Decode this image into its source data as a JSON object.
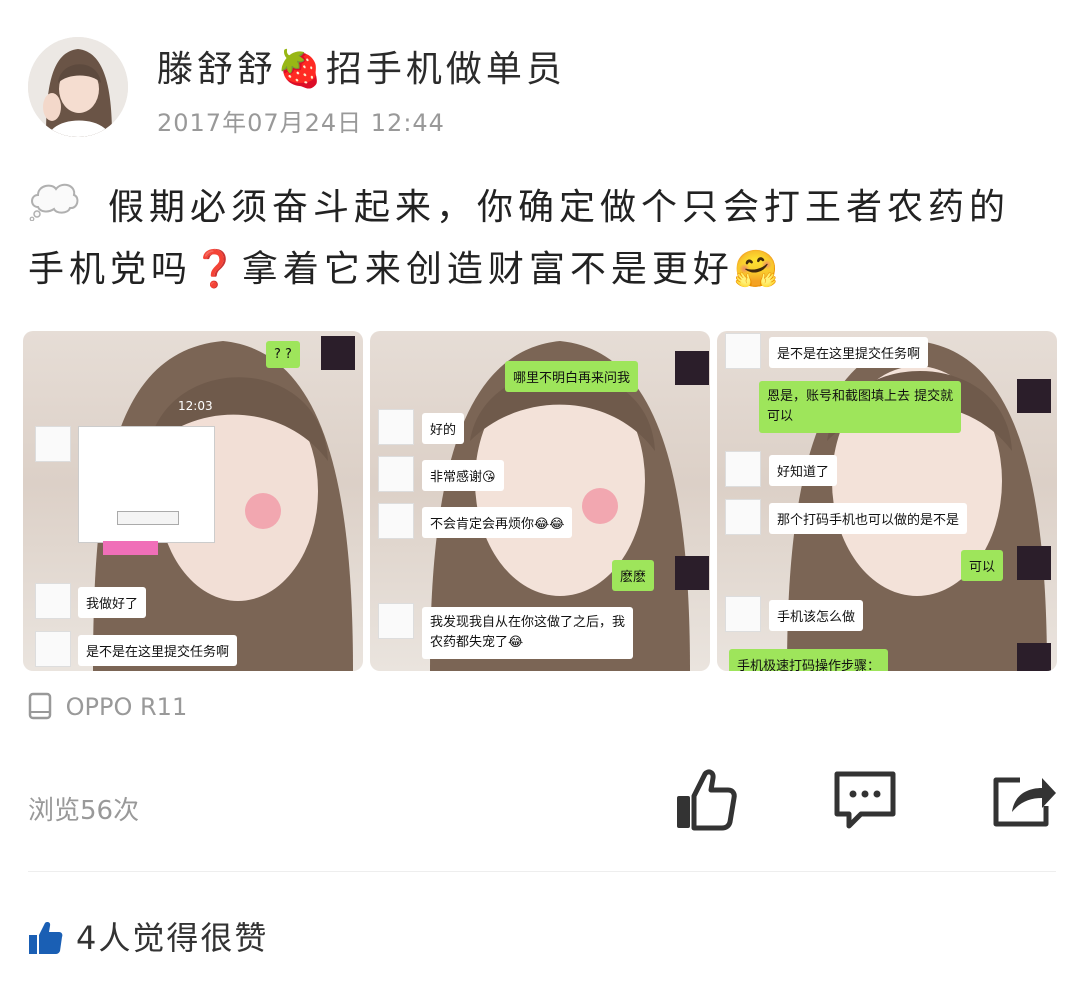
{
  "post": {
    "author": "滕舒舒🍓招手机做单员",
    "timestamp": "2017年07月24日 12:44",
    "text": "假期必须奋斗起来，你确定做个只会打王者农药的手机党吗❓拿着它来创造财富不是更好🤗",
    "device": "OPPO R11",
    "views": "浏览56次",
    "likes_text": "4人觉得很赞"
  },
  "photos": [
    {
      "clock": "12:03",
      "bubbles": [
        "? ?",
        "我做好了",
        "是不是在这里提交任务啊"
      ]
    },
    {
      "bubbles": [
        "哪里不明白再来问我",
        "好的",
        "非常感谢😘",
        "不会肯定会再烦你😂😂",
        "麽麽",
        "我发现我自从在你这做了之后，我",
        "农药都失宠了😂"
      ]
    },
    {
      "bubbles": [
        "是不是在这里提交任务啊",
        "恩是，账号和截图填上去 提交就",
        "可以",
        "好知道了",
        "那个打码手机也可以做的是不是",
        "可以",
        "手机该怎么做",
        "手机极速打码操作步骤："
      ]
    }
  ],
  "icons": {
    "like": "thumbs-up-icon",
    "comment": "comment-icon",
    "share": "share-icon",
    "device": "phone-icon",
    "thought": "thought-bubble-icon"
  },
  "colors": {
    "text": "#222222",
    "meta": "#999999",
    "icon": "#333333",
    "like_blue": "#1a5fb4",
    "chat_green": "#9ee55b"
  }
}
